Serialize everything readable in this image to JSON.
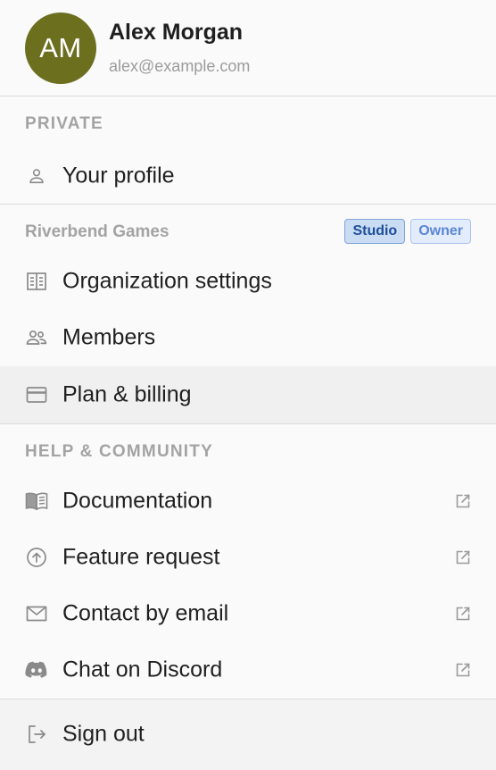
{
  "user": {
    "initials": "AM",
    "name": "Alex Morgan",
    "email": "alex@example.com",
    "avatar_color": "#6b6f1e"
  },
  "private": {
    "label": "PRIVATE",
    "items": [
      {
        "label": "Your profile",
        "icon": "user-icon"
      }
    ]
  },
  "org": {
    "name": "Riverbend Games",
    "badges": [
      "Studio",
      "Owner"
    ],
    "items": [
      {
        "label": "Organization settings",
        "icon": "building-icon"
      },
      {
        "label": "Members",
        "icon": "users-icon"
      },
      {
        "label": "Plan & billing",
        "icon": "credit-card-icon",
        "hovered": true
      }
    ]
  },
  "help": {
    "label": "HELP & COMMUNITY",
    "items": [
      {
        "label": "Documentation",
        "icon": "book-icon",
        "external": true
      },
      {
        "label": "Feature request",
        "icon": "arrow-up-circle-icon",
        "external": true
      },
      {
        "label": "Contact by email",
        "icon": "mail-icon",
        "external": true
      },
      {
        "label": "Chat on Discord",
        "icon": "discord-icon",
        "external": true
      }
    ]
  },
  "signout": {
    "label": "Sign out",
    "icon": "sign-out-icon"
  }
}
